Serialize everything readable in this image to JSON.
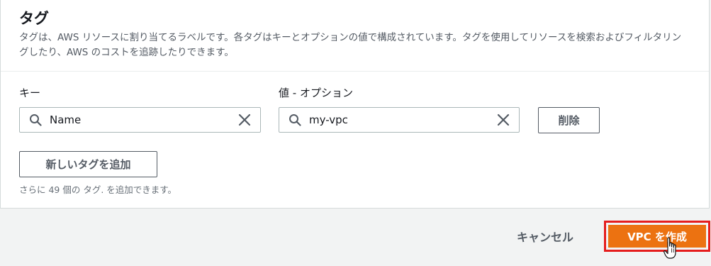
{
  "tags": {
    "title": "タグ",
    "description": "タグは、AWS リソースに割り当てるラベルです。各タグはキーとオプションの値で構成されています。タグを使用してリソースを検索およびフィルタリングしたり、AWS のコストを追跡したりできます。",
    "key_label": "キー",
    "value_label": "値 - オプション",
    "rows": [
      {
        "key": "Name",
        "value": "my-vpc",
        "remove_label": "削除"
      }
    ],
    "add_label": "新しいタグを追加",
    "remaining_hint": "さらに 49 個の タグ. を追加できます。"
  },
  "footer": {
    "cancel_label": "キャンセル",
    "create_label": "VPC を作成"
  },
  "colors": {
    "primary": "#ec7211",
    "highlight": "#e51d1d"
  },
  "icons": [
    "search-icon",
    "close-icon",
    "hand-cursor-icon"
  ]
}
